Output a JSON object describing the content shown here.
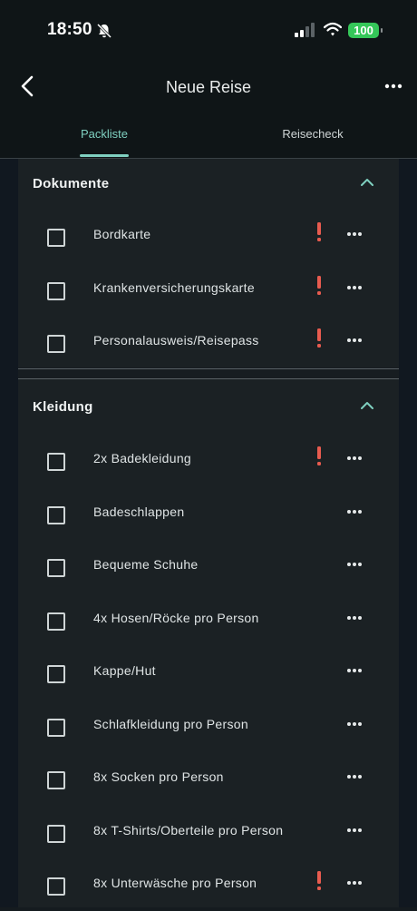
{
  "status_bar": {
    "time": "18:50",
    "battery": "100"
  },
  "nav": {
    "title": "Neue Reise",
    "tabs": [
      {
        "label": "Packliste",
        "active": true
      },
      {
        "label": "Reisecheck",
        "active": false
      }
    ]
  },
  "sections": [
    {
      "title": "Dokumente",
      "items": [
        {
          "label": "Bordkarte",
          "important": true
        },
        {
          "label": "Krankenversicherungskarte",
          "important": true
        },
        {
          "label": "Personalausweis/Reisepass",
          "important": true
        }
      ]
    },
    {
      "title": "Kleidung",
      "items": [
        {
          "label": "2x Badekleidung",
          "important": true
        },
        {
          "label": "Badeschlappen",
          "important": false
        },
        {
          "label": "Bequeme Schuhe",
          "important": false
        },
        {
          "label": "4x Hosen/Röcke pro Person",
          "important": false
        },
        {
          "label": "Kappe/Hut",
          "important": false
        },
        {
          "label": "Schlafkleidung pro Person",
          "important": false
        },
        {
          "label": "8x Socken pro Person",
          "important": false
        },
        {
          "label": "8x T-Shirts/Oberteile pro Person",
          "important": false
        },
        {
          "label": "8x Unterwäsche pro Person",
          "important": true
        }
      ]
    }
  ],
  "colors": {
    "accent": "#7fd0c0",
    "important": "#e85b4f",
    "background": "#151b1f"
  }
}
